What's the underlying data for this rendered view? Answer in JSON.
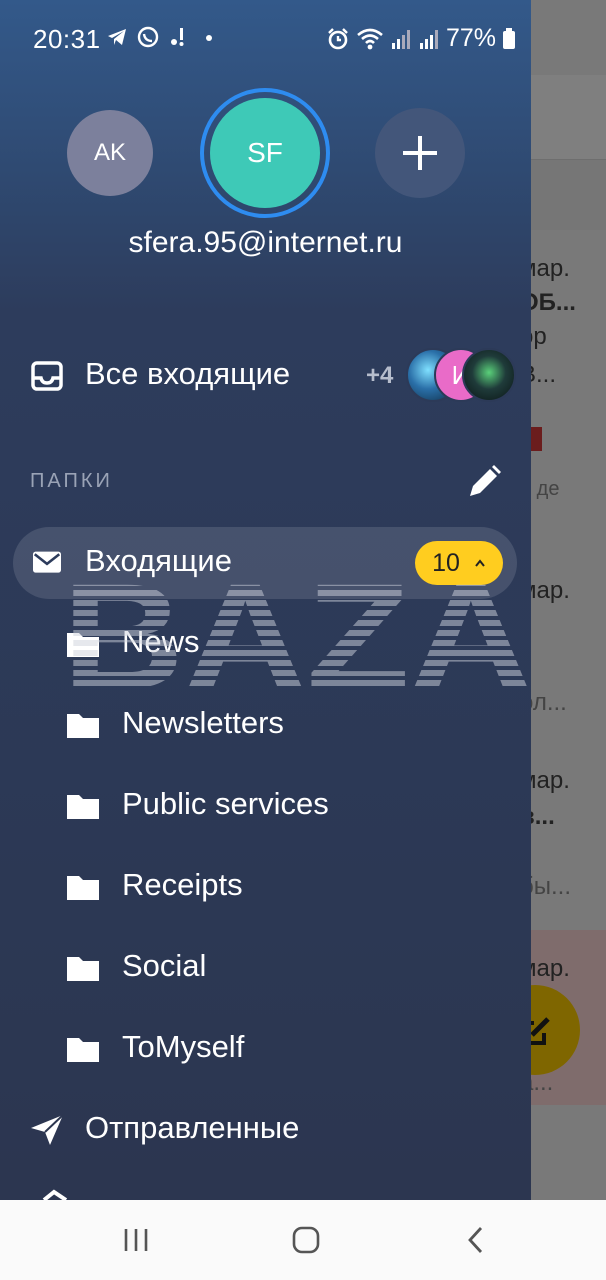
{
  "status_bar": {
    "time": "20:31",
    "battery": "77%"
  },
  "accounts": {
    "account_1": "AK",
    "account_2": "SF",
    "active_email": "sfera.95@internet.ru"
  },
  "all_inbox": {
    "label": "Все входящие",
    "more_count": "+4",
    "avatar_letter": "И"
  },
  "folders": {
    "header": "ПАПКИ",
    "inbox": {
      "label": "Входящие",
      "unread": "10"
    },
    "subfolders": [
      "News",
      "Newsletters",
      "Public services",
      "Receipts",
      "Social",
      "ToMyself"
    ],
    "sent": "Отправленные"
  },
  "background": {
    "items": [
      "мар.",
      "ОБ...",
      "ор",
      "В...",
      "о де",
      "мар.",
      "ол...",
      "мар.",
      "в...",
      "бы...",
      "мар.",
      "а..."
    ]
  },
  "watermark": "BAZA",
  "colors": {
    "badge": "#ffcd1f",
    "active_ring": "#2e8cf0",
    "active_avatar": "#3ec9b7",
    "fab": "#ffcc00"
  }
}
